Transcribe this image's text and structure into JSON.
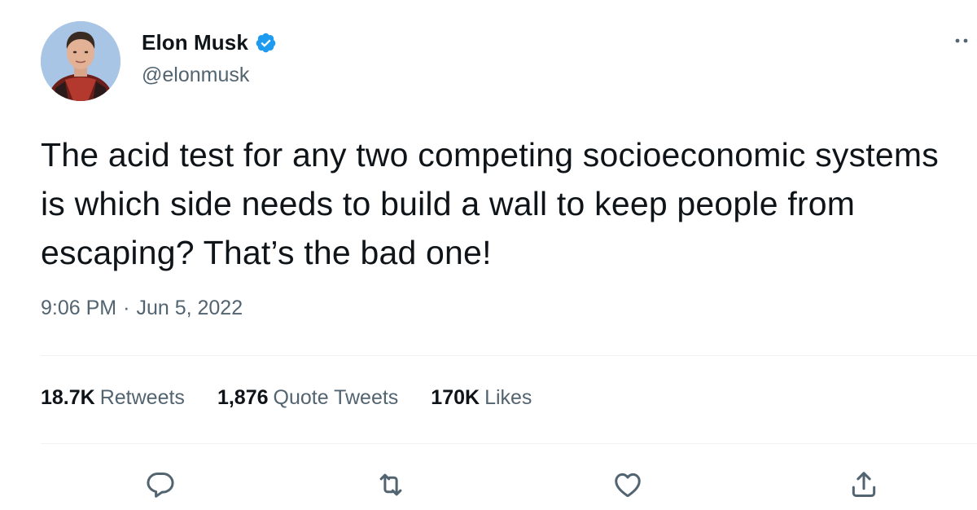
{
  "author": {
    "display_name": "Elon Musk",
    "handle": "@elonmusk",
    "verified": true,
    "verified_color": "#1d9bf0"
  },
  "tweet": {
    "text": "The acid test for any two competing socioeconomic systems is which side needs to build a wall to keep people from escaping? That’s the bad one!",
    "time": "9:06 PM",
    "separator": "·",
    "date": "Jun 5, 2022"
  },
  "stats": {
    "retweets": {
      "count": "18.7K",
      "label": "Retweets"
    },
    "quotes": {
      "count": "1,876",
      "label": "Quote Tweets"
    },
    "likes": {
      "count": "170K",
      "label": "Likes"
    }
  },
  "actions": [
    "reply-icon",
    "retweet-icon",
    "like-icon",
    "share-icon"
  ],
  "colors": {
    "text_primary": "#0f1419",
    "text_secondary": "#536471",
    "divider": "#eff3f4"
  }
}
